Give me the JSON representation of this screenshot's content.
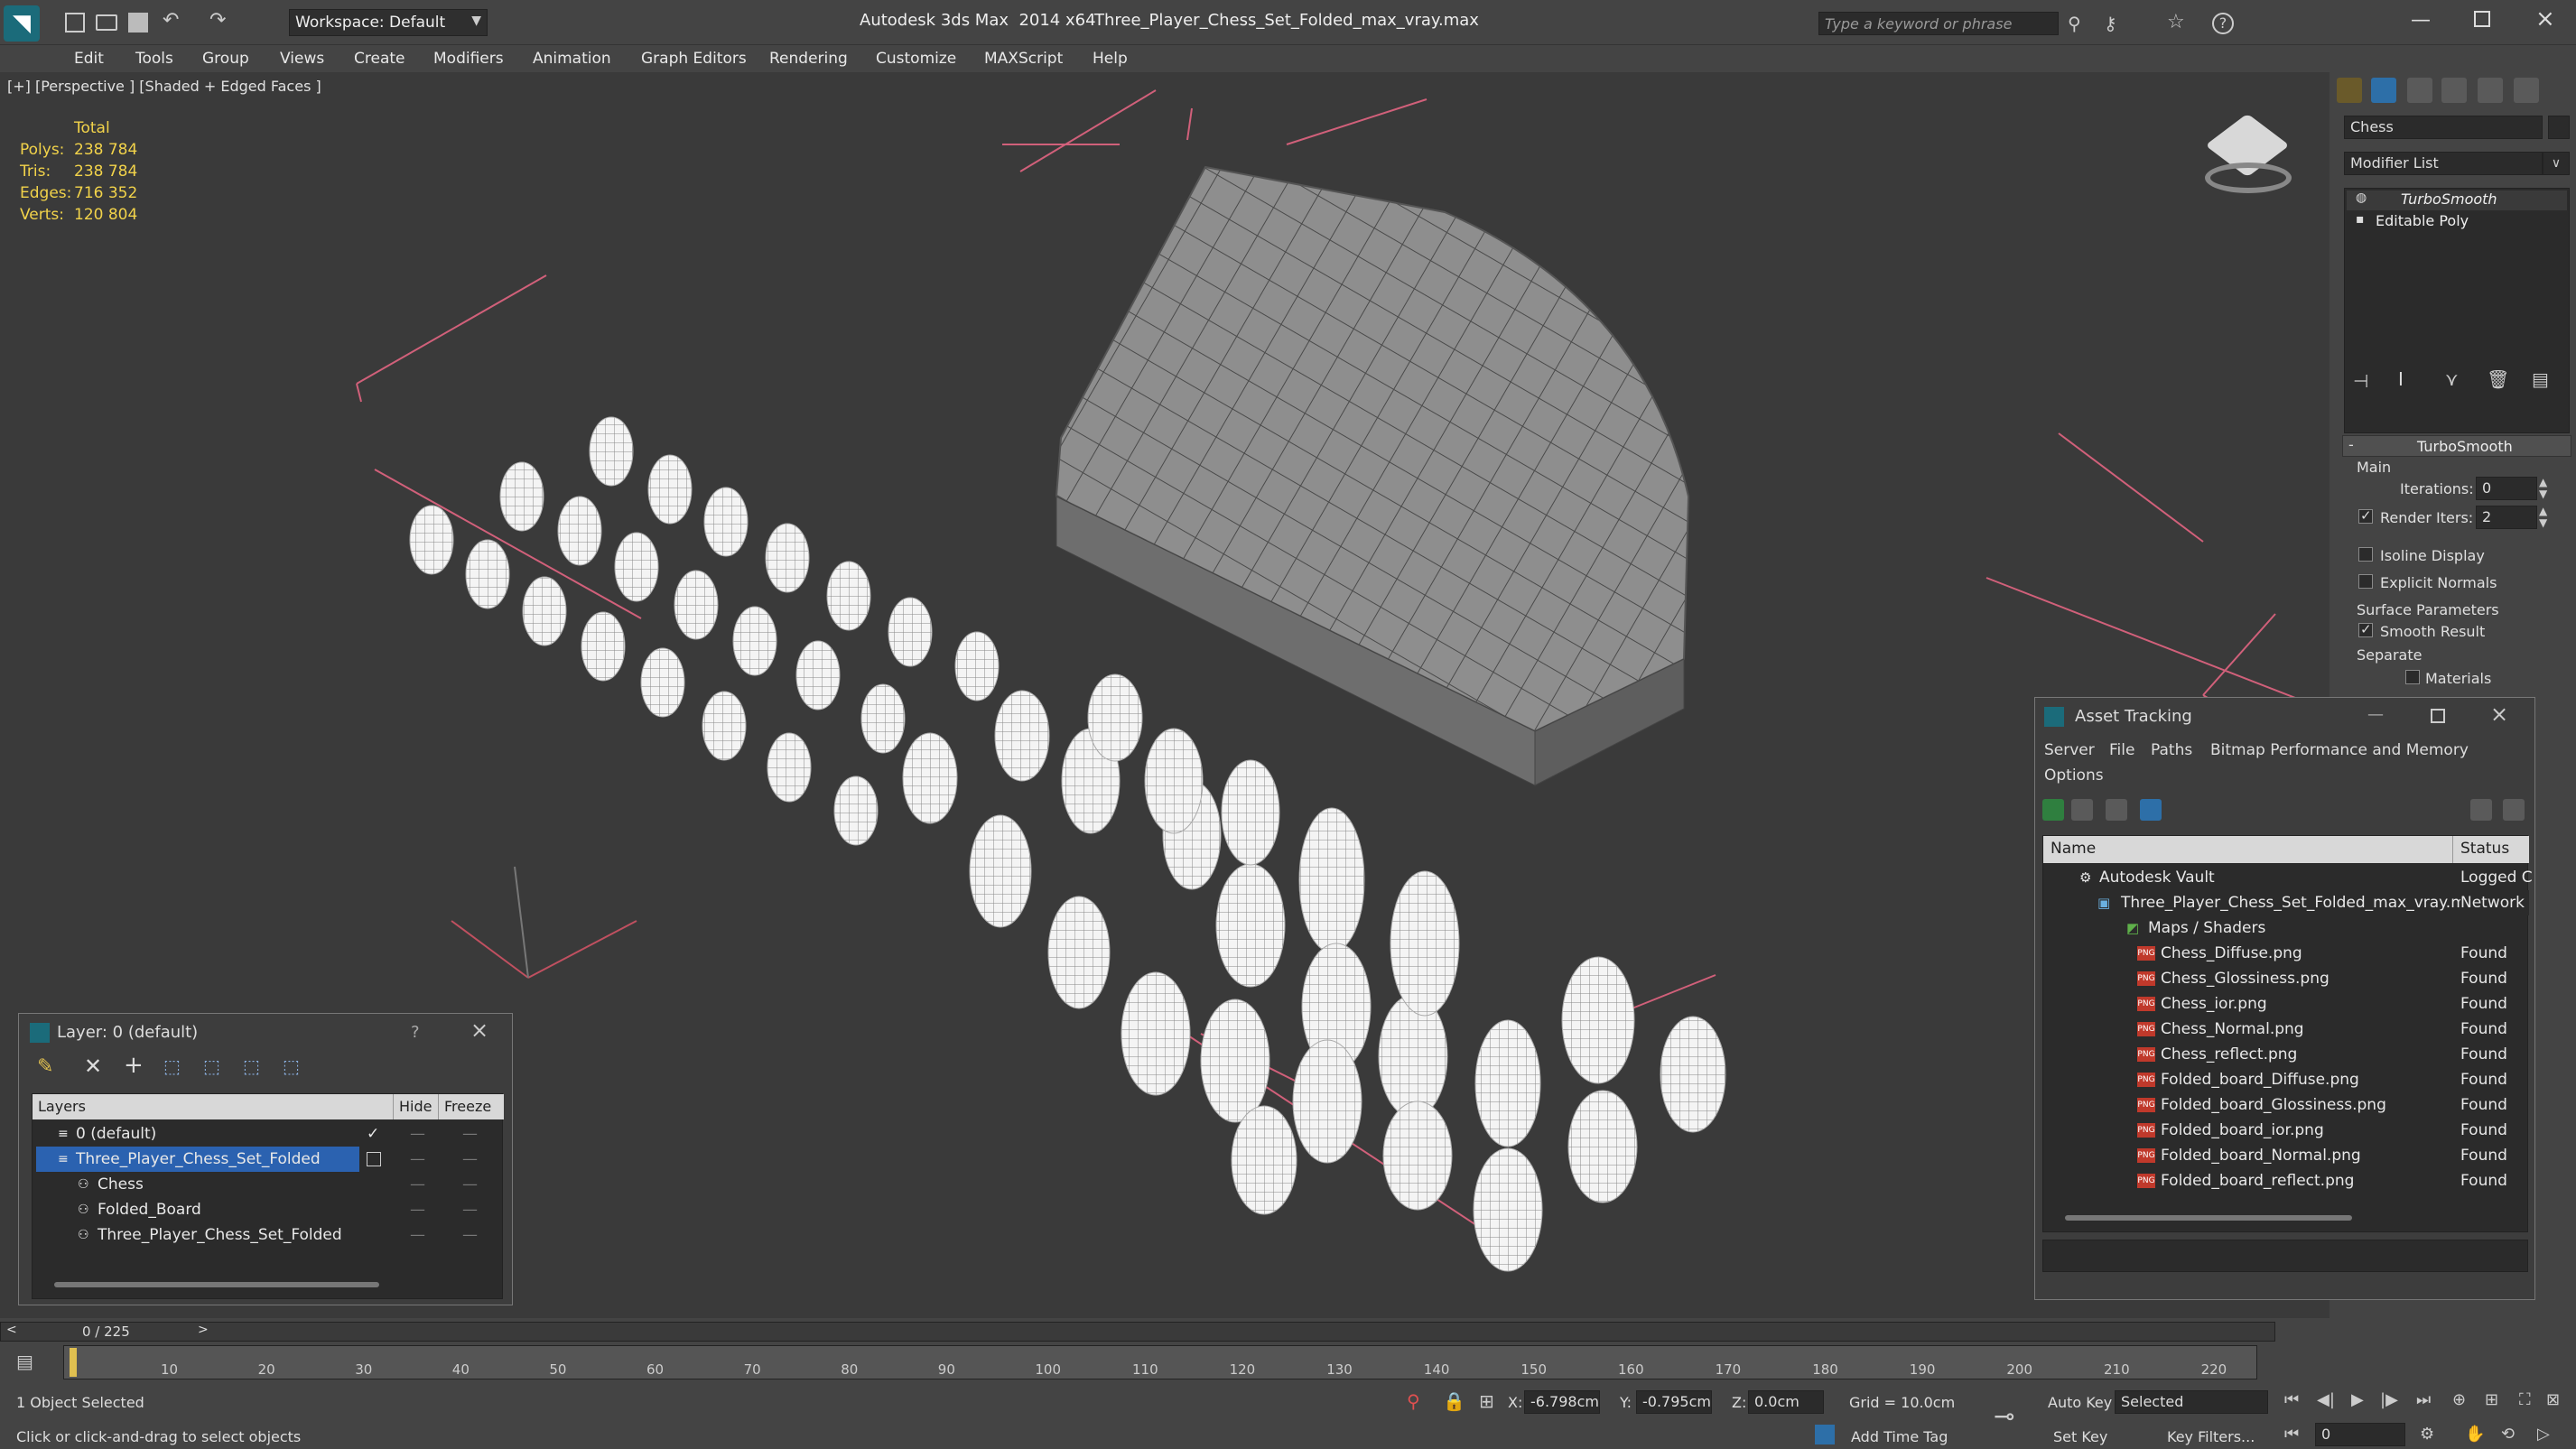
{
  "titlebar": {
    "workspace": "Workspace: Default",
    "app_title": "Autodesk 3ds Max  2014 x64",
    "file_name": "Three_Player_Chess_Set_Folded_max_vray.max",
    "search_placeholder": "Type a keyword or phrase"
  },
  "menu": [
    "Edit",
    "Tools",
    "Group",
    "Views",
    "Create",
    "Modifiers",
    "Animation",
    "Graph Editors",
    "Rendering",
    "Customize",
    "MAXScript",
    "Help"
  ],
  "viewport": {
    "label": "[+] [Perspective ] [Shaded + Edged Faces ]",
    "stats": {
      "total": "Total",
      "polys_label": "Polys:",
      "polys": "238 784",
      "tris_label": "Tris:",
      "tris": "238 784",
      "edges_label": "Edges:",
      "edges": "716 352",
      "verts_label": "Verts:",
      "verts": "120 804"
    }
  },
  "cmdpanel": {
    "object_name": "Chess",
    "modifier_list": "Modifier List",
    "stack": [
      "TurboSmooth",
      "Editable Poly"
    ],
    "rollout_title": "TurboSmooth",
    "main_group": "Main",
    "iterations_label": "Iterations:",
    "iterations_value": "0",
    "render_iters_label": "Render Iters:",
    "render_iters_value": "2",
    "isoline": "Isoline Display",
    "explicit_normals": "Explicit Normals",
    "surface_params": "Surface Parameters",
    "smooth_result": "Smooth Result",
    "separate": "Separate",
    "materials": "Materials"
  },
  "asset_tracking": {
    "title": "Asset Tracking",
    "menu": [
      "Server",
      "File",
      "Paths",
      "Bitmap Performance and Memory"
    ],
    "options": "Options",
    "col_name": "Name",
    "col_status": "Status",
    "rows": [
      {
        "name": "Autodesk Vault",
        "status": "Logged C"
      },
      {
        "name": "Three_Player_Chess_Set_Folded_max_vray.max",
        "status": "Network"
      },
      {
        "name": "Maps / Shaders",
        "status": ""
      },
      {
        "name": "Chess_Diffuse.png",
        "status": "Found"
      },
      {
        "name": "Chess_Glossiness.png",
        "status": "Found"
      },
      {
        "name": "Chess_ior.png",
        "status": "Found"
      },
      {
        "name": "Chess_Normal.png",
        "status": "Found"
      },
      {
        "name": "Chess_reflect.png",
        "status": "Found"
      },
      {
        "name": "Folded_board_Diffuse.png",
        "status": "Found"
      },
      {
        "name": "Folded_board_Glossiness.png",
        "status": "Found"
      },
      {
        "name": "Folded_board_ior.png",
        "status": "Found"
      },
      {
        "name": "Folded_board_Normal.png",
        "status": "Found"
      },
      {
        "name": "Folded_board_reflect.png",
        "status": "Found"
      }
    ]
  },
  "layer_window": {
    "title": "Layer: 0 (default)",
    "help": "?",
    "col_layers": "Layers",
    "col_hide": "Hide",
    "col_freeze": "Freeze",
    "rows": [
      "0 (default)",
      "Three_Player_Chess_Set_Folded",
      "Chess",
      "Folded_Board",
      "Three_Player_Chess_Set_Folded"
    ]
  },
  "timeline": {
    "frame_counter": "0 / 225",
    "ticks": [
      "10",
      "20",
      "30",
      "40",
      "50",
      "60",
      "70",
      "80",
      "90",
      "100",
      "110",
      "120",
      "130",
      "140",
      "150",
      "160",
      "170",
      "180",
      "190",
      "200",
      "210",
      "220"
    ]
  },
  "status": {
    "selected": "1 Object Selected",
    "hint": "Click or click-and-drag to select objects",
    "x_label": "X:",
    "x_value": "-6.798cm",
    "y_label": "Y:",
    "y_value": "-0.795cm",
    "z_label": "Z:",
    "z_value": "0.0cm",
    "grid": "Grid = 10.0cm",
    "add_time_tag": "Add Time Tag",
    "auto_key": "Auto Key",
    "selected_mode": "Selected",
    "set_key": "Set Key",
    "key_filters": "Key Filters...",
    "frame": "0"
  }
}
